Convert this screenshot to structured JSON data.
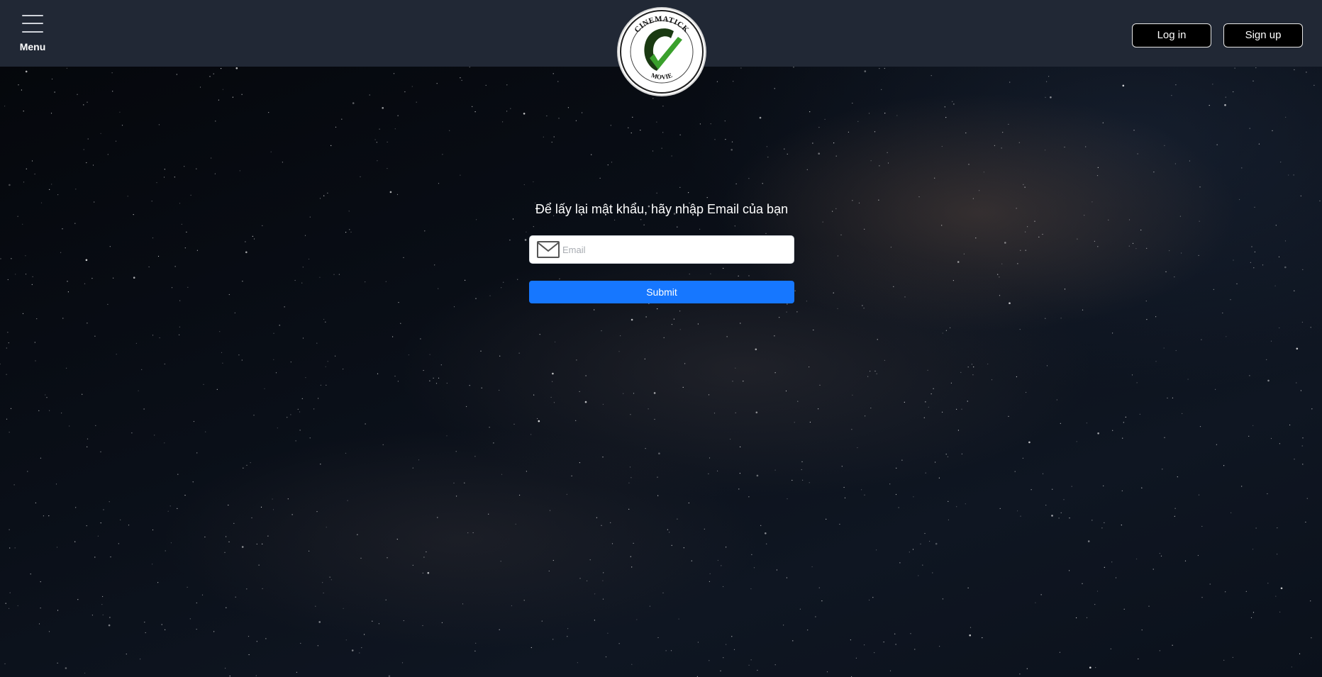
{
  "header": {
    "menu_label": "Menu",
    "login_label": "Log in",
    "signup_label": "Sign up",
    "logo": {
      "top_text": "CINEMATICK",
      "bottom_text": "MOVIE",
      "icon": "checkmark-c-logo-icon"
    }
  },
  "recover_form": {
    "title": "Để lấy lại mật khẩu, hãy nhập Email của bạn",
    "email_placeholder": "Email",
    "email_value": "",
    "email_icon": "envelope-icon",
    "submit_label": "Submit"
  },
  "colors": {
    "navbar": "#212835",
    "primary": "#1677ff",
    "logo_green": "#3aa02c"
  }
}
